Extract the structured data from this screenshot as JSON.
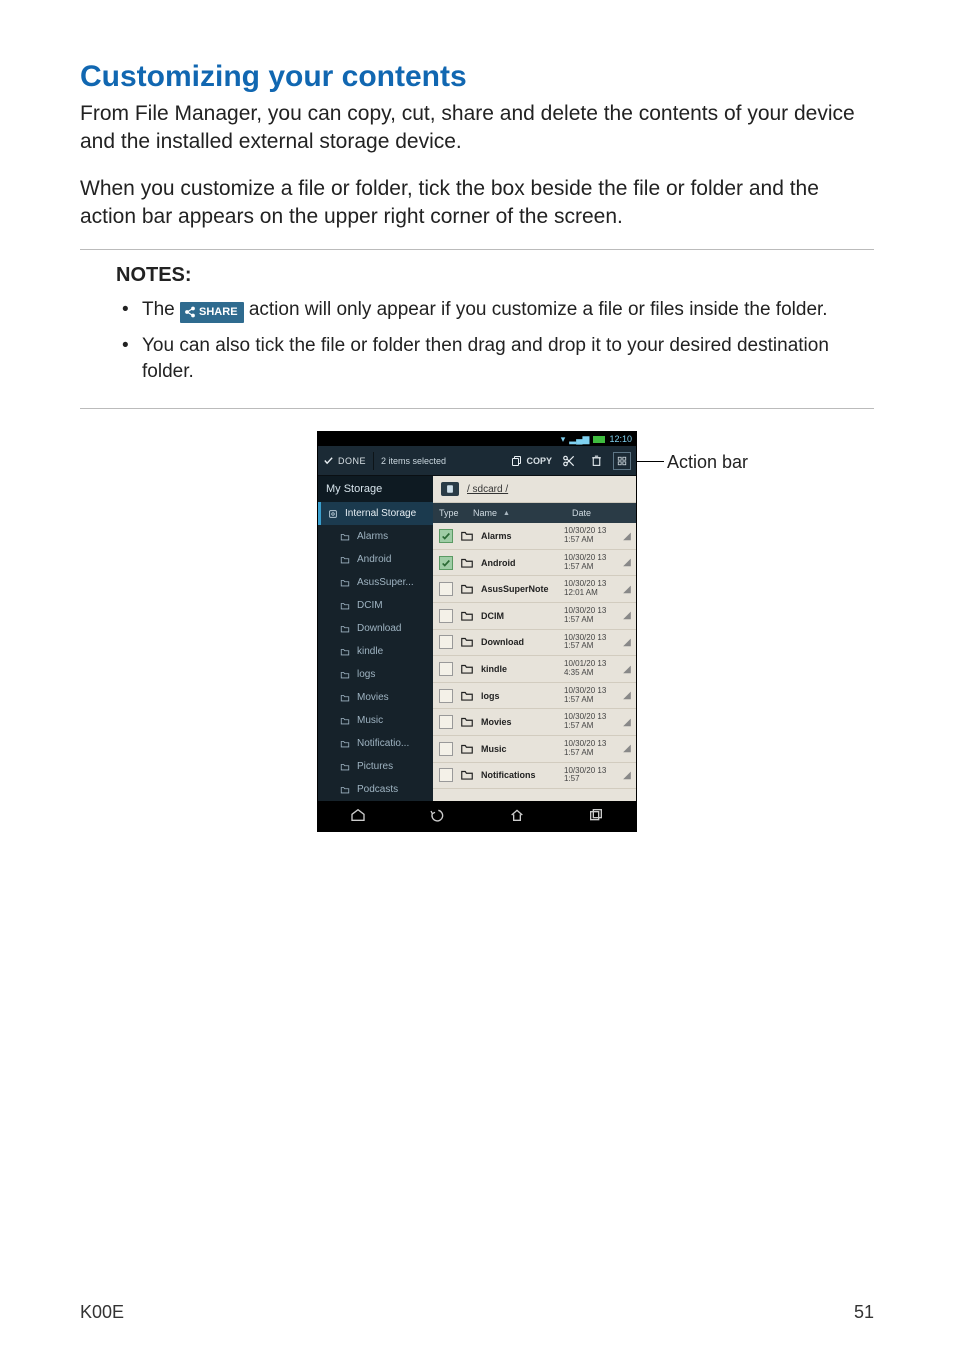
{
  "heading": "Customizing your contents",
  "para1": "From File Manager, you can copy, cut, share and delete the contents of your device and the installed external storage device.",
  "para2": "When you customize a file or folder, tick the box beside the file or folder and the action bar appears on the upper right corner of the screen.",
  "notes_title": "NOTES:",
  "note1_a": "The ",
  "share_chip": "SHARE",
  "note1_b": " action will only appear if you customize a file or files inside the folder.",
  "note2": "You can also tick the file or folder then drag and drop it to your desired destination folder.",
  "callout": "Action bar",
  "status_time": "12:10",
  "actionbar": {
    "done": "DONE",
    "selected": "2 items selected",
    "copy": "COPY"
  },
  "sidebar": {
    "head": "My Storage",
    "root": "Internal Storage",
    "items": [
      "Alarms",
      "Android",
      "AsusSuper...",
      "DCIM",
      "Download",
      "kindle",
      "logs",
      "Movies",
      "Music",
      "Notificatio...",
      "Pictures",
      "Podcasts"
    ]
  },
  "path_label": "/ sdcard /",
  "cols": {
    "type": "Type",
    "name": "Name",
    "date": "Date"
  },
  "rows": [
    {
      "name": "Alarms",
      "date": "10/30/20\n13 1:57\nAM",
      "checked": true
    },
    {
      "name": "Android",
      "date": "10/30/20\n13 1:57\nAM",
      "checked": true
    },
    {
      "name": "AsusSuperNote",
      "date": "10/30/20\n13 12:01\nAM",
      "checked": false
    },
    {
      "name": "DCIM",
      "date": "10/30/20\n13 1:57\nAM",
      "checked": false
    },
    {
      "name": "Download",
      "date": "10/30/20\n13 1:57\nAM",
      "checked": false
    },
    {
      "name": "kindle",
      "date": "10/01/20\n13 4:35\nAM",
      "checked": false
    },
    {
      "name": "logs",
      "date": "10/30/20\n13 1:57\nAM",
      "checked": false
    },
    {
      "name": "Movies",
      "date": "10/30/20\n13 1:57\nAM",
      "checked": false
    },
    {
      "name": "Music",
      "date": "10/30/20\n13 1:57\nAM",
      "checked": false
    },
    {
      "name": "Notifications",
      "date": "10/30/20\n13 1:57",
      "checked": false
    }
  ],
  "footer": {
    "model": "K00E",
    "page": "51"
  }
}
